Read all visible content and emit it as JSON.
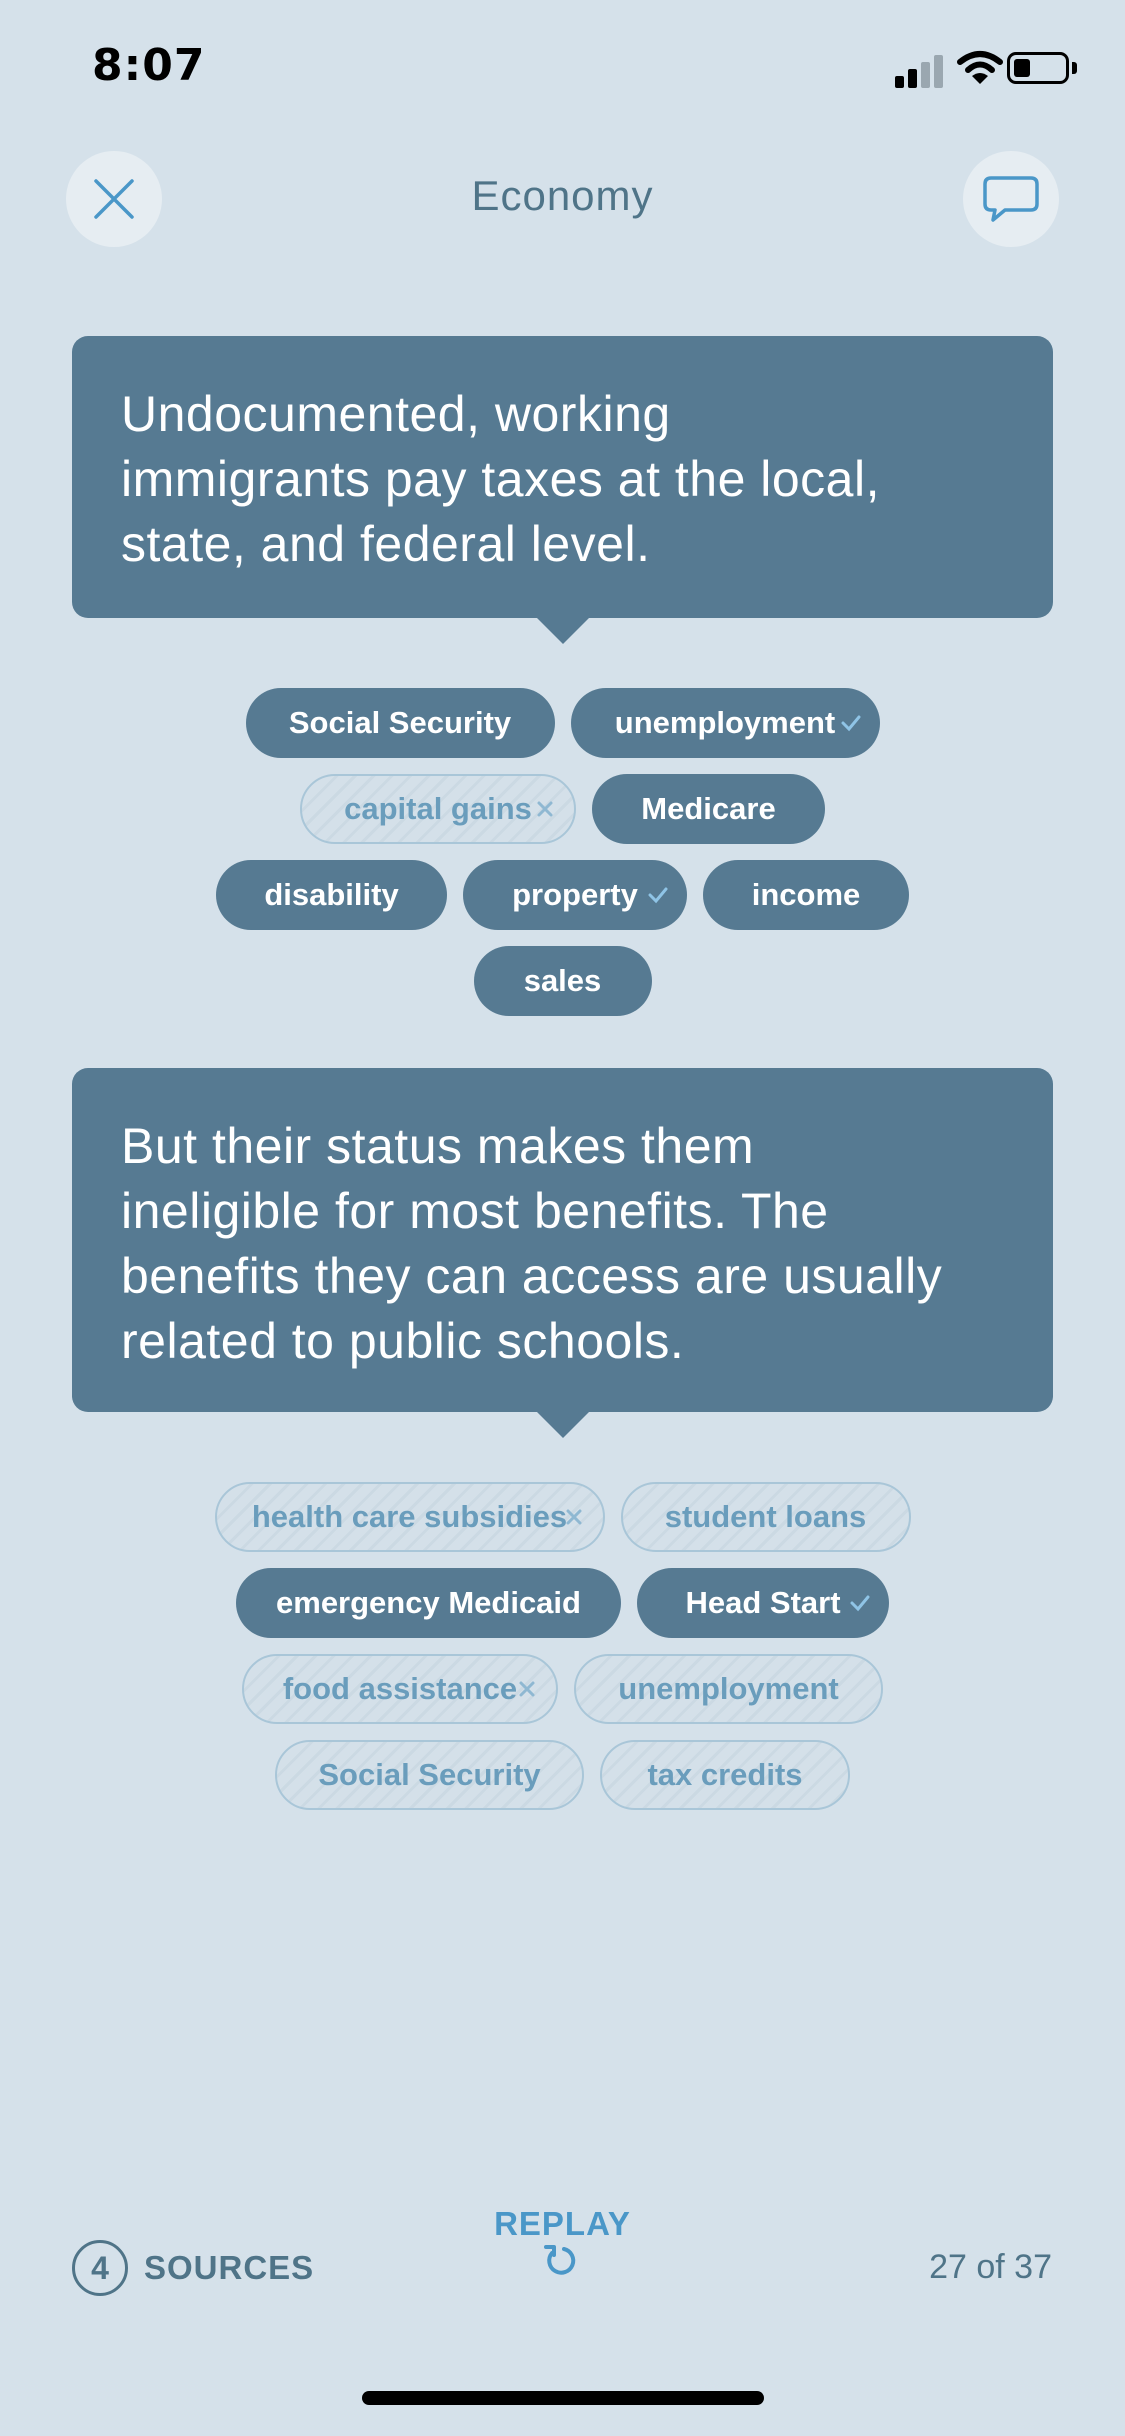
{
  "status_bar": {
    "time": "8:07"
  },
  "header": {
    "title": "Economy",
    "close_icon": "close-icon",
    "chat_icon": "chat-bubble-icon"
  },
  "card1": {
    "lines": [
      "Undocumented, working",
      "immigrants pay taxes at the local,",
      "state, and federal level."
    ]
  },
  "taxes": {
    "row1": [
      {
        "label": "Social Security",
        "state": "on",
        "mark": ""
      },
      {
        "label": "unemployment",
        "state": "on",
        "mark": "check"
      }
    ],
    "row2": [
      {
        "label": "capital gains",
        "state": "off",
        "mark": "x"
      },
      {
        "label": "Medicare",
        "state": "on",
        "mark": ""
      }
    ],
    "row3": [
      {
        "label": "disability",
        "state": "on",
        "mark": ""
      },
      {
        "label": "property",
        "state": "on",
        "mark": "check"
      },
      {
        "label": "income",
        "state": "on",
        "mark": ""
      }
    ],
    "row4": [
      {
        "label": "sales",
        "state": "on",
        "mark": ""
      }
    ]
  },
  "card2": {
    "lines": [
      "But their status makes them",
      "ineligible for most benefits. The",
      "benefits they can access are usually",
      "related to public schools."
    ]
  },
  "benefits": {
    "row1": [
      {
        "label": "health care subsidies",
        "state": "off",
        "mark": "x"
      },
      {
        "label": "student loans",
        "state": "off",
        "mark": ""
      }
    ],
    "row2": [
      {
        "label": "emergency Medicaid",
        "state": "on",
        "mark": ""
      },
      {
        "label": "Head Start",
        "state": "on",
        "mark": "check"
      }
    ],
    "row3": [
      {
        "label": "food assistance",
        "state": "off",
        "mark": "x"
      },
      {
        "label": "unemployment",
        "state": "off",
        "mark": ""
      }
    ],
    "row4": [
      {
        "label": "Social Security",
        "state": "off",
        "mark": ""
      },
      {
        "label": "tax credits",
        "state": "off",
        "mark": ""
      }
    ]
  },
  "footer": {
    "sources_count": "4",
    "sources_label": "SOURCES",
    "replay_label": "REPLAY",
    "page_count": "27 of 37"
  },
  "colors": {
    "background": "#d5e1ea",
    "card": "#567a92",
    "accent": "#4a97c8",
    "muted_text": "#4f7488"
  }
}
